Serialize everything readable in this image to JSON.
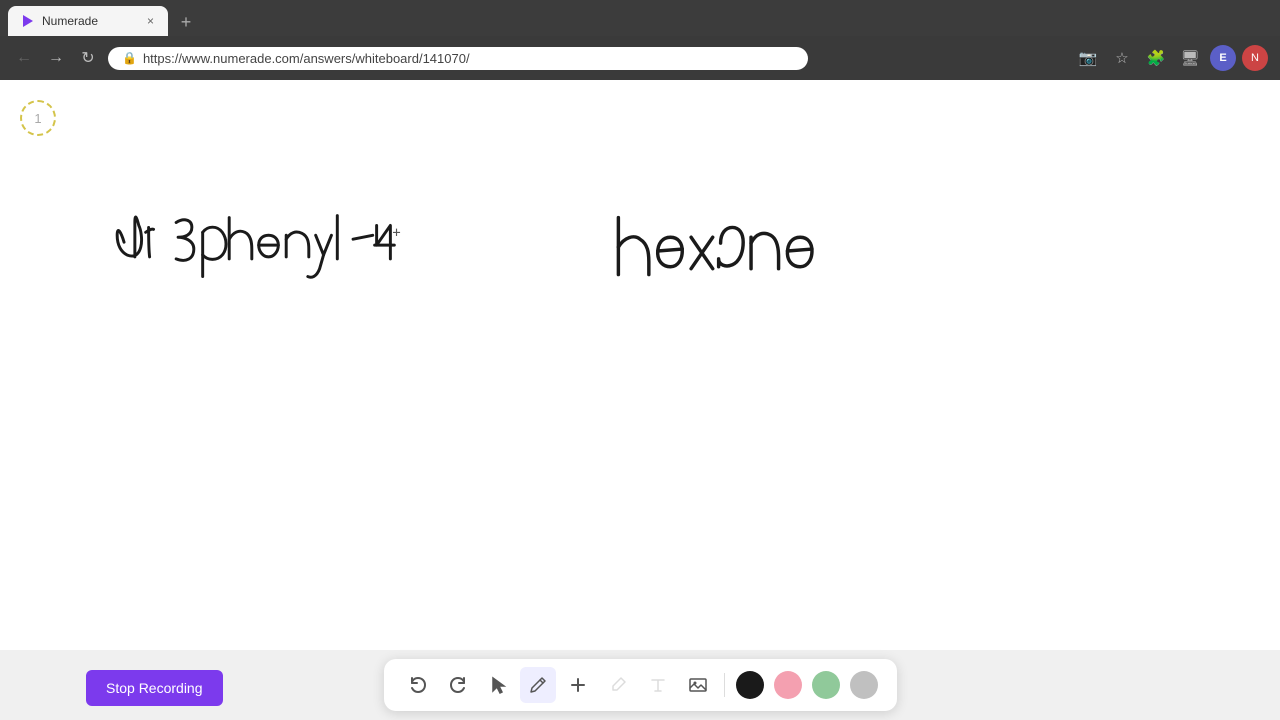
{
  "browser": {
    "tab": {
      "title": "Numerade",
      "favicon": "▶",
      "close_label": "×",
      "new_tab_label": "+"
    },
    "address": {
      "url": "https://www.numerade.com/answers/whiteboard/141070/",
      "lock_icon": "🔒"
    },
    "toolbar": {
      "back_icon": "←",
      "forward_icon": "→",
      "refresh_icon": "↻",
      "camera_icon": "📷",
      "star_icon": "☆",
      "profile_label": "E",
      "ext_label": "N"
    }
  },
  "whiteboard": {
    "page_number": "1",
    "handwriting_text": "a) 3phenyl -4- hexane"
  },
  "bottom_toolbar": {
    "stop_recording_label": "Stop Recording",
    "tools": [
      {
        "name": "undo",
        "icon": "↺",
        "label": "Undo"
      },
      {
        "name": "redo",
        "icon": "↻",
        "label": "Redo"
      },
      {
        "name": "select",
        "icon": "↖",
        "label": "Select"
      },
      {
        "name": "pen",
        "icon": "✏",
        "label": "Pen"
      },
      {
        "name": "add",
        "icon": "+",
        "label": "Add"
      },
      {
        "name": "highlighter",
        "icon": "/",
        "label": "Highlighter"
      },
      {
        "name": "text",
        "icon": "T",
        "label": "Text"
      },
      {
        "name": "image",
        "icon": "🖼",
        "label": "Image"
      }
    ],
    "colors": [
      {
        "name": "black",
        "hex": "#1a1a1a",
        "label": "Black"
      },
      {
        "name": "pink",
        "hex": "#f4a0b0",
        "label": "Pink"
      },
      {
        "name": "green",
        "hex": "#90c99a",
        "label": "Green"
      },
      {
        "name": "gray",
        "hex": "#c0c0c0",
        "label": "Gray"
      }
    ]
  }
}
